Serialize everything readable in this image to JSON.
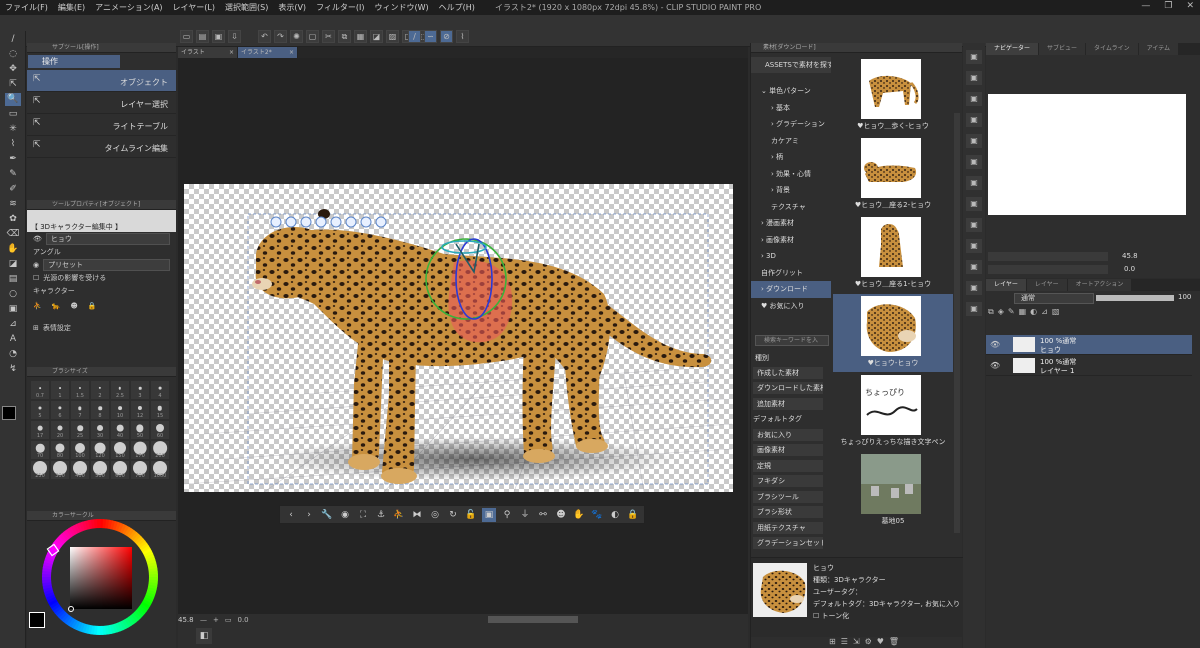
{
  "window": {
    "title": "イラスト2* (1920 x 1080px 72dpi 45.8%) - CLIP STUDIO PAINT PRO",
    "controls": [
      "—",
      "❐",
      "✕"
    ]
  },
  "menu": [
    "ファイル(F)",
    "編集(E)",
    "アニメーション(A)",
    "レイヤー(L)",
    "選択範囲(S)",
    "表示(V)",
    "フィルター(I)",
    "ウィンドウ(W)",
    "ヘルプ(H)"
  ],
  "tabs": [
    {
      "label": "イラスト",
      "active": false
    },
    {
      "label": "イラスト2*",
      "active": true
    }
  ],
  "subtool": {
    "header": "サブツール[操作]",
    "category": "操作",
    "items": [
      {
        "label": "オブジェクト",
        "icon": "pointer-icon",
        "active": true
      },
      {
        "label": "レイヤー選択",
        "icon": "layer-select-icon",
        "active": false
      },
      {
        "label": "ライトテーブル",
        "icon": "lighttable-icon",
        "active": false
      },
      {
        "label": "タイムライン編集",
        "icon": "timeline-icon",
        "active": false
      }
    ]
  },
  "tool_property": {
    "header": "ツールプロパティ[オブジェクト]",
    "banner": "【 3Dキャラクター編集中 】",
    "layer_value": "ヒョウ",
    "angle_label": "アングル",
    "preset_label": "プリセット",
    "light_label": "光源の影響を受ける",
    "character_label": "キャラクター",
    "expression_label": "表情設定"
  },
  "brush_size": {
    "header": "ブラシサイズ",
    "sizes": [
      "0.7",
      "1",
      "1.5",
      "2",
      "2.5",
      "3",
      "4",
      "5",
      "6",
      "7",
      "8",
      "10",
      "12",
      "15",
      "17",
      "20",
      "25",
      "30",
      "40",
      "50",
      "60",
      "70",
      "80",
      "100",
      "120",
      "150",
      "170",
      "200",
      "250",
      "300",
      "400",
      "500",
      "600",
      "700",
      "1000"
    ]
  },
  "color_circle": {
    "header": "カラーサークル",
    "main_color": "#000000",
    "sub_color": "#ffffff"
  },
  "canvas": {
    "zoom": "45.8",
    "angle": "0.0"
  },
  "material": {
    "header": "素材[ダウンロード]",
    "assets_button": "ASSETSで素材を探す",
    "tree": [
      {
        "label": "単色パターン",
        "level": 0,
        "prefix": "⌄"
      },
      {
        "label": "基本",
        "level": 1,
        "prefix": "›"
      },
      {
        "label": "グラデーション",
        "level": 1,
        "prefix": "›"
      },
      {
        "label": "カケアミ",
        "level": 1,
        "prefix": ""
      },
      {
        "label": "柄",
        "level": 1,
        "prefix": "›"
      },
      {
        "label": "効果・心情",
        "level": 1,
        "prefix": "›"
      },
      {
        "label": "背景",
        "level": 1,
        "prefix": "›"
      },
      {
        "label": "テクスチャ",
        "level": 1,
        "prefix": ""
      },
      {
        "label": "漫画素材",
        "level": 0,
        "prefix": "›"
      },
      {
        "label": "画像素材",
        "level": 0,
        "prefix": "›"
      },
      {
        "label": "3D",
        "level": 0,
        "prefix": "›"
      },
      {
        "label": "自作グリット",
        "level": 0,
        "prefix": ""
      },
      {
        "label": "ダウンロード",
        "level": 0,
        "prefix": "›",
        "active": true
      },
      {
        "label": "お気に入り",
        "level": 0,
        "prefix": "♥"
      }
    ],
    "search_placeholder": "検索キーワードを入",
    "kind_label": "種別",
    "kind_tags": [
      "作成した素材",
      "ダウンロードした素材",
      "追加素材"
    ],
    "default_tag_label": "デフォルトタグ",
    "default_tags": [
      "お気に入り",
      "画像素材",
      "定規",
      "フキダシ",
      "ブラシツール",
      "ブラシ形状",
      "用紙テクスチャ",
      "グラデーションセット"
    ],
    "thumbnails": [
      {
        "caption": "♥ヒョウ＿歩く-ヒョウ",
        "kind": "leopard-walk",
        "active": false
      },
      {
        "caption": "♥ヒョウ＿座る2-ヒョウ",
        "kind": "leopard-lie",
        "active": false
      },
      {
        "caption": "♥ヒョウ＿座る1-ヒョウ",
        "kind": "leopard-sit",
        "active": false
      },
      {
        "caption": "♥ヒョウ-ヒョウ",
        "kind": "leopard-head",
        "active": true
      },
      {
        "caption": "ちょっぴりえっちな描き文字ペン",
        "kind": "pen",
        "active": false
      },
      {
        "caption": "墓地05",
        "kind": "graveyard",
        "active": false
      }
    ],
    "info": {
      "name": "ヒョウ",
      "type": "種類：3Dキャラクター",
      "user_tag": "ユーザータグ：",
      "default_tag": "デフォルトタグ：3Dキャラクター, お気に入り",
      "tone": "トーン化"
    }
  },
  "navigator": {
    "tabs": [
      "ナビゲーター",
      "サブビュー",
      "タイムライン",
      "アイテム"
    ],
    "zoom": "45.8",
    "angle": "0.0"
  },
  "layer": {
    "tabs": [
      "レイヤー",
      "レイヤー",
      "オートアクション"
    ],
    "blend": "通常",
    "opacity": "100",
    "rows": [
      {
        "line1": "100 %通常",
        "line2": "ヒョウ",
        "active": true
      },
      {
        "line1": "100 %通常",
        "line2": "レイヤー 1",
        "active": false
      }
    ]
  },
  "colors": {
    "accent": "#4a5f82",
    "bg": "#2b2b2b",
    "leopard": "#c8903e"
  }
}
